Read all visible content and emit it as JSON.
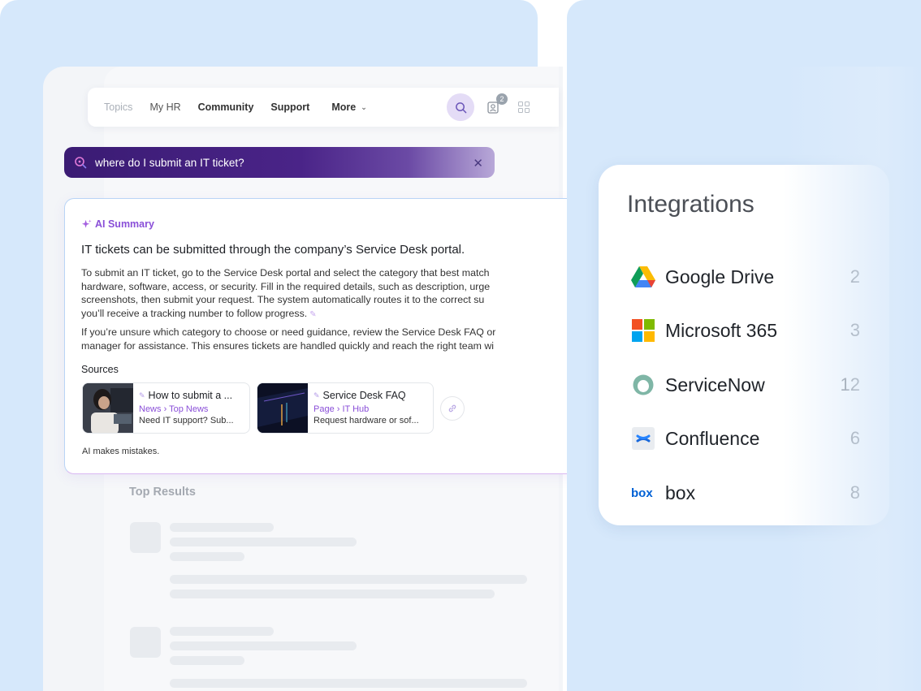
{
  "nav": {
    "items": [
      {
        "label": "Topics"
      },
      {
        "label": "My HR"
      },
      {
        "label": "Community"
      },
      {
        "label": "Support"
      }
    ],
    "more_label": "More",
    "notification_count": "2"
  },
  "search": {
    "query": "where do I submit an IT ticket?"
  },
  "ai_summary": {
    "title": "AI Summary",
    "headline": "IT tickets can be submitted through the company’s Service Desk portal.",
    "paragraph1_lines": [
      "To submit an IT ticket, go to the Service Desk portal and select the category that best match",
      "hardware, software, access, or security. Fill in the required details, such as description, urge",
      "screenshots, then submit your request. The system automatically routes it to the correct su",
      "you’ll receive a tracking number to follow progress."
    ],
    "paragraph2_lines": [
      "If you’re unsure which category to choose or need guidance, review the Service Desk FAQ or",
      "manager for assistance. This ensures tickets are handled quickly and reach the right team wi"
    ],
    "sources_label": "Sources",
    "sources": [
      {
        "title": "How to submit a ...",
        "type": "News",
        "location": "Top News",
        "description": "Need IT support? Sub..."
      },
      {
        "title": "Service Desk FAQ",
        "type": "Page",
        "location": "IT Hub",
        "description": "Request hardware or sof..."
      }
    ],
    "disclaimer": "AI makes mistakes."
  },
  "results": {
    "heading": "Top Results"
  },
  "integrations": {
    "title": "Integrations",
    "items": [
      {
        "name": "Google Drive",
        "count": "2",
        "icon": "google-drive-icon"
      },
      {
        "name": "Microsoft 365",
        "count": "3",
        "icon": "microsoft-365-icon"
      },
      {
        "name": "ServiceNow",
        "count": "12",
        "icon": "servicenow-icon"
      },
      {
        "name": "Confluence",
        "count": "6",
        "icon": "confluence-icon"
      },
      {
        "name": "box",
        "count": "8",
        "icon": "box-icon"
      }
    ]
  },
  "colors": {
    "background_panel": "#d6e8fb",
    "accent_purple": "#8a4fd8",
    "search_bar": "#3a1b73"
  }
}
